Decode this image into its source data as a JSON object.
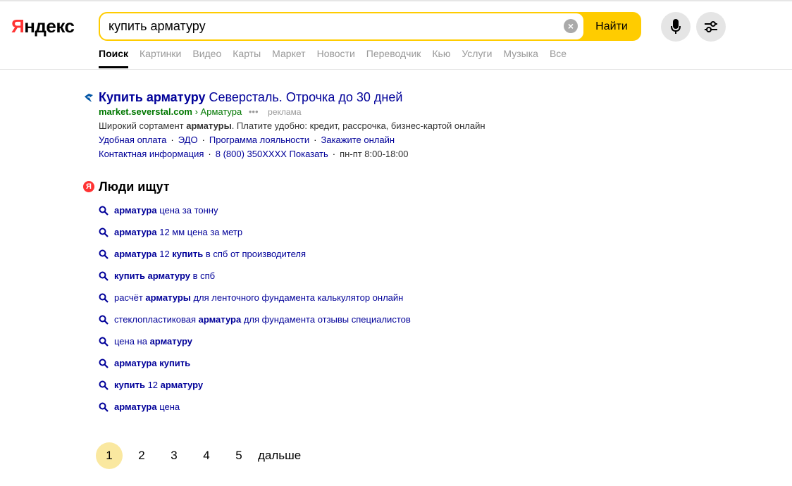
{
  "header": {
    "logo_first": "Я",
    "logo_rest": "ндекс",
    "search_value": "купить арматуру",
    "search_button": "Найти"
  },
  "nav": [
    "Поиск",
    "Картинки",
    "Видео",
    "Карты",
    "Маркет",
    "Новости",
    "Переводчик",
    "Кью",
    "Услуги",
    "Музыка",
    "Все"
  ],
  "ad": {
    "title_bold": "Купить арматуру",
    "title_rest": " Северсталь. Отрочка до 30 дней",
    "domain": "market.severstal.com",
    "path": "› Арматура",
    "dots": "•••",
    "label": "реклама",
    "text_before": "Широкий сортамент ",
    "text_bold": "арматуры",
    "text_after": ". Платите удобно: кредит, рассрочка, бизнес-картой онлайн",
    "links": [
      "Удобная оплата",
      "ЭДО",
      "Программа лояльности",
      "Закажите онлайн"
    ],
    "contact_link": "Контактная информация",
    "phone": "8 (800) 350XXXX Показать",
    "hours": "пн-пт 8:00-18:00"
  },
  "people": {
    "icon": "Я",
    "title": "Люди ищут",
    "suggestions": [
      {
        "bold1": "арматура",
        "rest1": " цена за тонну"
      },
      {
        "bold1": "арматура",
        "rest1": " 12 мм цена за метр"
      },
      {
        "bold1": "арматура",
        "rest1": " 12 ",
        "bold2": "купить",
        "rest2": " в спб от производителя"
      },
      {
        "bold1": "купить арматуру",
        "rest1": " в спб"
      },
      {
        "pre": "расчёт ",
        "bold1": "арматуры",
        "rest1": " для ленточного фундамента калькулятор онлайн"
      },
      {
        "pre": "стеклопластиковая ",
        "bold1": "арматура",
        "rest1": " для фундамента отзывы специалистов"
      },
      {
        "pre": "цена на ",
        "bold1": "арматуру"
      },
      {
        "bold1": "арматура купить"
      },
      {
        "bold1": "купить",
        "rest1": " 12 ",
        "bold2": "арматуру"
      },
      {
        "bold1": "арматура",
        "rest1": " цена"
      }
    ]
  },
  "pager": {
    "pages": [
      "1",
      "2",
      "3",
      "4",
      "5"
    ],
    "current": "1",
    "next": "дальше"
  }
}
